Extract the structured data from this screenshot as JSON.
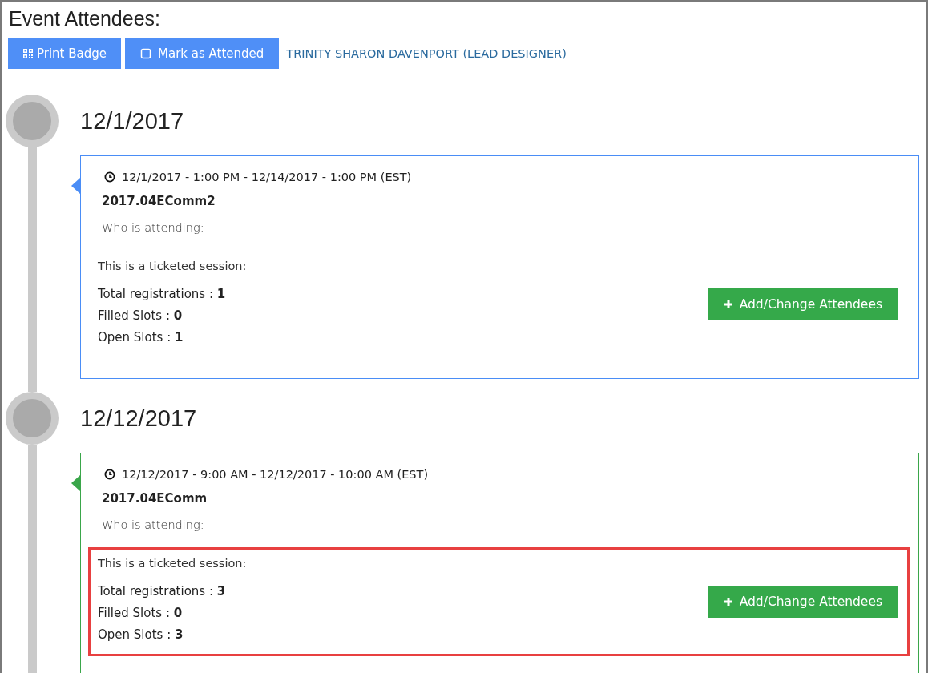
{
  "title": "Event Attendees:",
  "toolbar": {
    "buttons": [
      {
        "kind": "print",
        "label": "Print Badge"
      },
      {
        "kind": "mark",
        "label": "Mark as Attended"
      }
    ],
    "attendee": "TRINITY SHARON DAVENPORT (LEAD DESIGNER)"
  },
  "sessions": [
    {
      "date": "12/1/2017",
      "color": "#4a8df6",
      "time": "12/1/2017 - 1:00 PM - 12/14/2017 - 1:00 PM (EST)",
      "name": "2017.04EComm2",
      "who_label": "Who is attending:",
      "ticket_label": "This is a ticketed session:",
      "highlighted": false,
      "stats": [
        {
          "label": "Total registrations : ",
          "value": "1"
        },
        {
          "label": "Filled Slots : ",
          "value": "0"
        },
        {
          "label": "Open Slots : ",
          "value": "1"
        }
      ],
      "button": "Add/Change Attendees"
    },
    {
      "date": "12/12/2017",
      "color": "#3aa64a",
      "time": "12/12/2017 - 9:00 AM - 12/12/2017 - 10:00 AM (EST)",
      "name": "2017.04EComm",
      "who_label": "Who is attending:",
      "ticket_label": "This is a ticketed session:",
      "highlighted": true,
      "stats": [
        {
          "label": "Total registrations : ",
          "value": "3"
        },
        {
          "label": "Filled Slots : ",
          "value": "0"
        },
        {
          "label": "Open Slots : ",
          "value": "3"
        }
      ],
      "button": "Add/Change Attendees"
    }
  ]
}
